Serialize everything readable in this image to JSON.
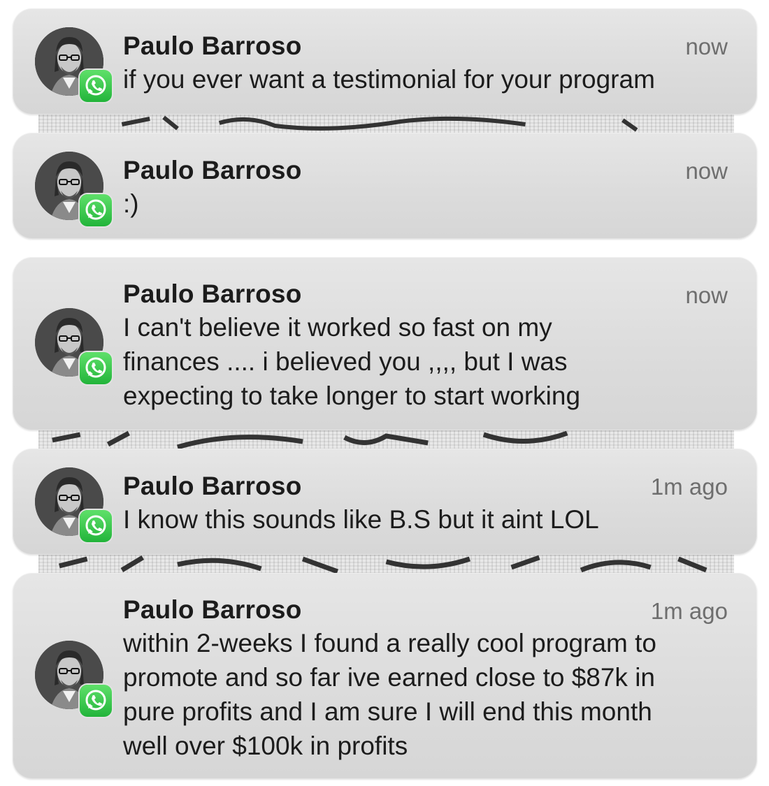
{
  "notifications": [
    {
      "sender": "Paulo Barroso",
      "time": "now",
      "message": "if you ever want a testimonial for your program",
      "avatar_icon": "profile-photo",
      "app_icon": "whatsapp-icon"
    },
    {
      "sender": "Paulo Barroso",
      "time": "now",
      "message": ":)",
      "avatar_icon": "profile-photo",
      "app_icon": "whatsapp-icon"
    },
    {
      "sender": "Paulo Barroso",
      "time": "now",
      "message": "I can't believe it worked so fast on my\nfinances .... i believed you ,,,, but I was\nexpecting to take longer to start working",
      "avatar_icon": "profile-photo",
      "app_icon": "whatsapp-icon"
    },
    {
      "sender": "Paulo Barroso",
      "time": "1m ago",
      "message": "I know this sounds like B.S but it aint LOL",
      "avatar_icon": "profile-photo",
      "app_icon": "whatsapp-icon"
    },
    {
      "sender": "Paulo Barroso",
      "time": "1m ago",
      "message": "within 2-weeks I found a really cool program to\npromote and so far ive earned close to $87k in\npure profits and I am sure I will end this month\nwell over $100k in profits",
      "avatar_icon": "profile-photo",
      "app_icon": "whatsapp-icon"
    }
  ],
  "colors": {
    "card_background": "#dedede",
    "whatsapp_green": "#25d366",
    "sender_text": "#1c1c1c",
    "time_text": "#6e6e6e"
  }
}
